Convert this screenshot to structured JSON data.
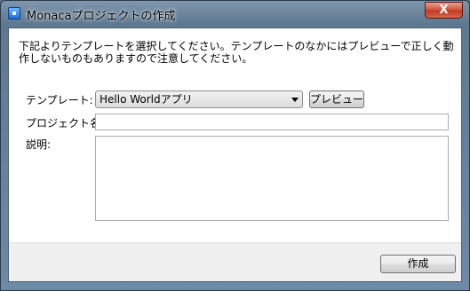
{
  "window": {
    "title": "Monacaプロジェクトの作成",
    "close_glyph": "X"
  },
  "form": {
    "description": "下記よりテンプレートを選択してください。テンプレートのなかにはプレビューで正しく動作しないものもありますので注意してください。",
    "template_label": "テンプレート:",
    "template_selected": "Hello Worldアプリ",
    "preview_button": "プレビュー",
    "project_name_label": "プロジェクト名:",
    "project_name_value": "",
    "description_label": "説明:",
    "description_value": ""
  },
  "footer": {
    "create_button": "作成"
  },
  "icons": {
    "app": "monaca-app-icon",
    "close": "close-icon",
    "dropdown": "chevron-down-icon"
  },
  "colors": {
    "close_button": "#c8432b",
    "footer": "#f0f0f0"
  }
}
